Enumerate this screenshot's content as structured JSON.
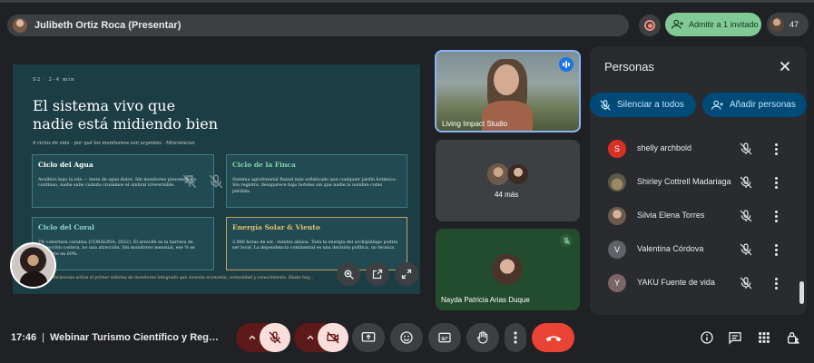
{
  "top_bar": {
    "presenter_label": "Julibeth Ortiz Roca (Presentar)",
    "admit_label": "Admitir a 1 invitado",
    "participant_count": "47"
  },
  "slide": {
    "kicker": "S2 · 2–4 min",
    "title_line1": "El sistema vivo que",
    "title_line2": "nadie está midiendo bien",
    "subtitle": "4 ciclos de vida · por qué los monitoreos son urgentes · Minciencias",
    "cards": [
      {
        "title": "Ciclo del Agua",
        "body": "Acuífero bajo la isla — lente de agua dulce. Sin monitoreo piezométrico continuo, nadie sabe cuándo cruzamos el umbral irreversible."
      },
      {
        "title": "Ciclo de la Finca",
        "body": "Sistema agroforestal Raizal más sofisticado que cualquier jardín botánico. Sin registro, desaparece bajo hoteles sin que nadie la nombre como pérdida."
      },
      {
        "title": "Ciclo del Coral",
        "body": "?% cobertura coralina (CORALINA, 2022). El arrecife es la barrera de protección costera, no una atracción. Sin monitoreo mensual, ese % se convierte en 60%."
      },
      {
        "title": "Energía Solar & Viento",
        "body": "2.800 horas de sol · vientos alisios. Toda la energía del archipiélago podría ser local. La dependencia continental es una decisión política, no técnica."
      }
    ],
    "footer": "Minciencias activa el primer sistema de monitoreo integrado que conecta economía, comunidad y conocimiento. Hasta hoy..."
  },
  "tiles": [
    {
      "name": "Living Impact Studio"
    },
    {
      "name": "44 más"
    },
    {
      "name": "Nayda Patricia Arias Duque"
    }
  ],
  "people_panel": {
    "title": "Personas",
    "mute_all_label": "Silenciar a todos",
    "add_people_label": "Añadir personas",
    "people": [
      {
        "name": "shelly archbold",
        "initial": "S",
        "color": "#d93025"
      },
      {
        "name": "Shirley Cottrell Madariaga",
        "initial": "",
        "color": "#7a6a4f"
      },
      {
        "name": "Silvia Elena Torres",
        "initial": "",
        "color": "#8d7b6b"
      },
      {
        "name": "Valentina Córdova",
        "initial": "V",
        "color": "#5f6368"
      },
      {
        "name": "YAKU Fuente de vida",
        "initial": "Y",
        "color": "#7c6566"
      }
    ]
  },
  "bottom_bar": {
    "time": "17:46",
    "separator": "|",
    "meeting_title": "Webinar Turismo Científico y Regeneración"
  },
  "colors": {
    "accent": "#8ab4f8",
    "admit_green": "#81c995",
    "hangup_red": "#ea4335",
    "slide_bg": "#1d3d45"
  }
}
